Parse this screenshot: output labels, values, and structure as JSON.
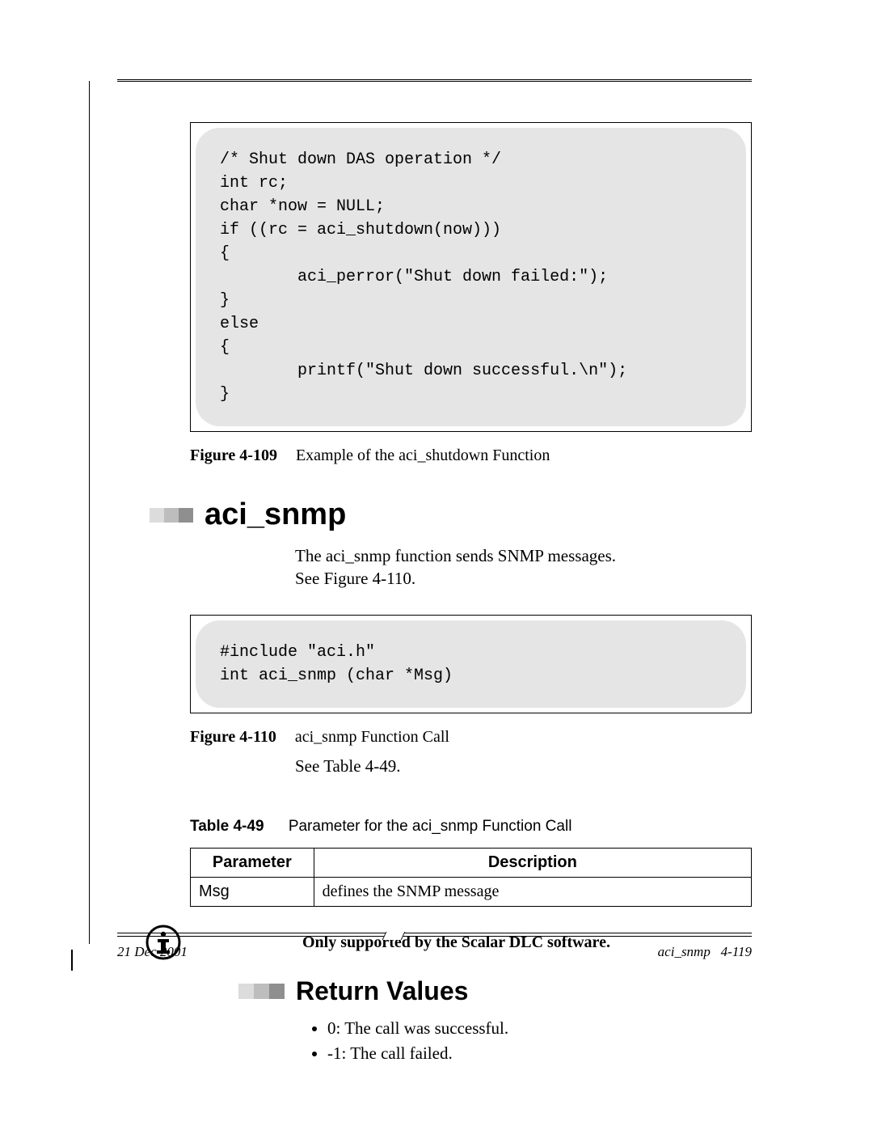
{
  "code1": "/* Shut down DAS operation */\nint rc;\nchar *now = NULL;\nif ((rc = aci_shutdown(now)))\n{\n        aci_perror(\"Shut down failed:\");\n}\nelse\n{\n        printf(\"Shut down successful.\\n\");\n}",
  "fig109": {
    "label": "Figure 4-109",
    "title": "Example of the aci_shutdown Function"
  },
  "section_h1": "aci_snmp",
  "para1": "The aci_snmp function sends SNMP messages. See Figure 4-110.",
  "code2": "#include \"aci.h\"\nint aci_snmp (char *Msg)",
  "fig110": {
    "label": "Figure 4-110",
    "title": "aci_snmp Function Call"
  },
  "para2": "See Table 4-49.",
  "table49": {
    "label": "Table 4-49",
    "title": "Parameter for the aci_snmp Function Call",
    "headers": [
      "Parameter",
      "Description"
    ],
    "rows": [
      {
        "param": "Msg",
        "desc": "defines the SNMP message"
      }
    ]
  },
  "note": "Only supported by the Scalar DLC software.",
  "section_h2": "Return Values",
  "returns": [
    "0: The call was successful.",
    "-1: The call failed."
  ],
  "footer": {
    "date": "21 Dec 2001",
    "section": "aci_snmp",
    "pagenum": "4-119"
  }
}
